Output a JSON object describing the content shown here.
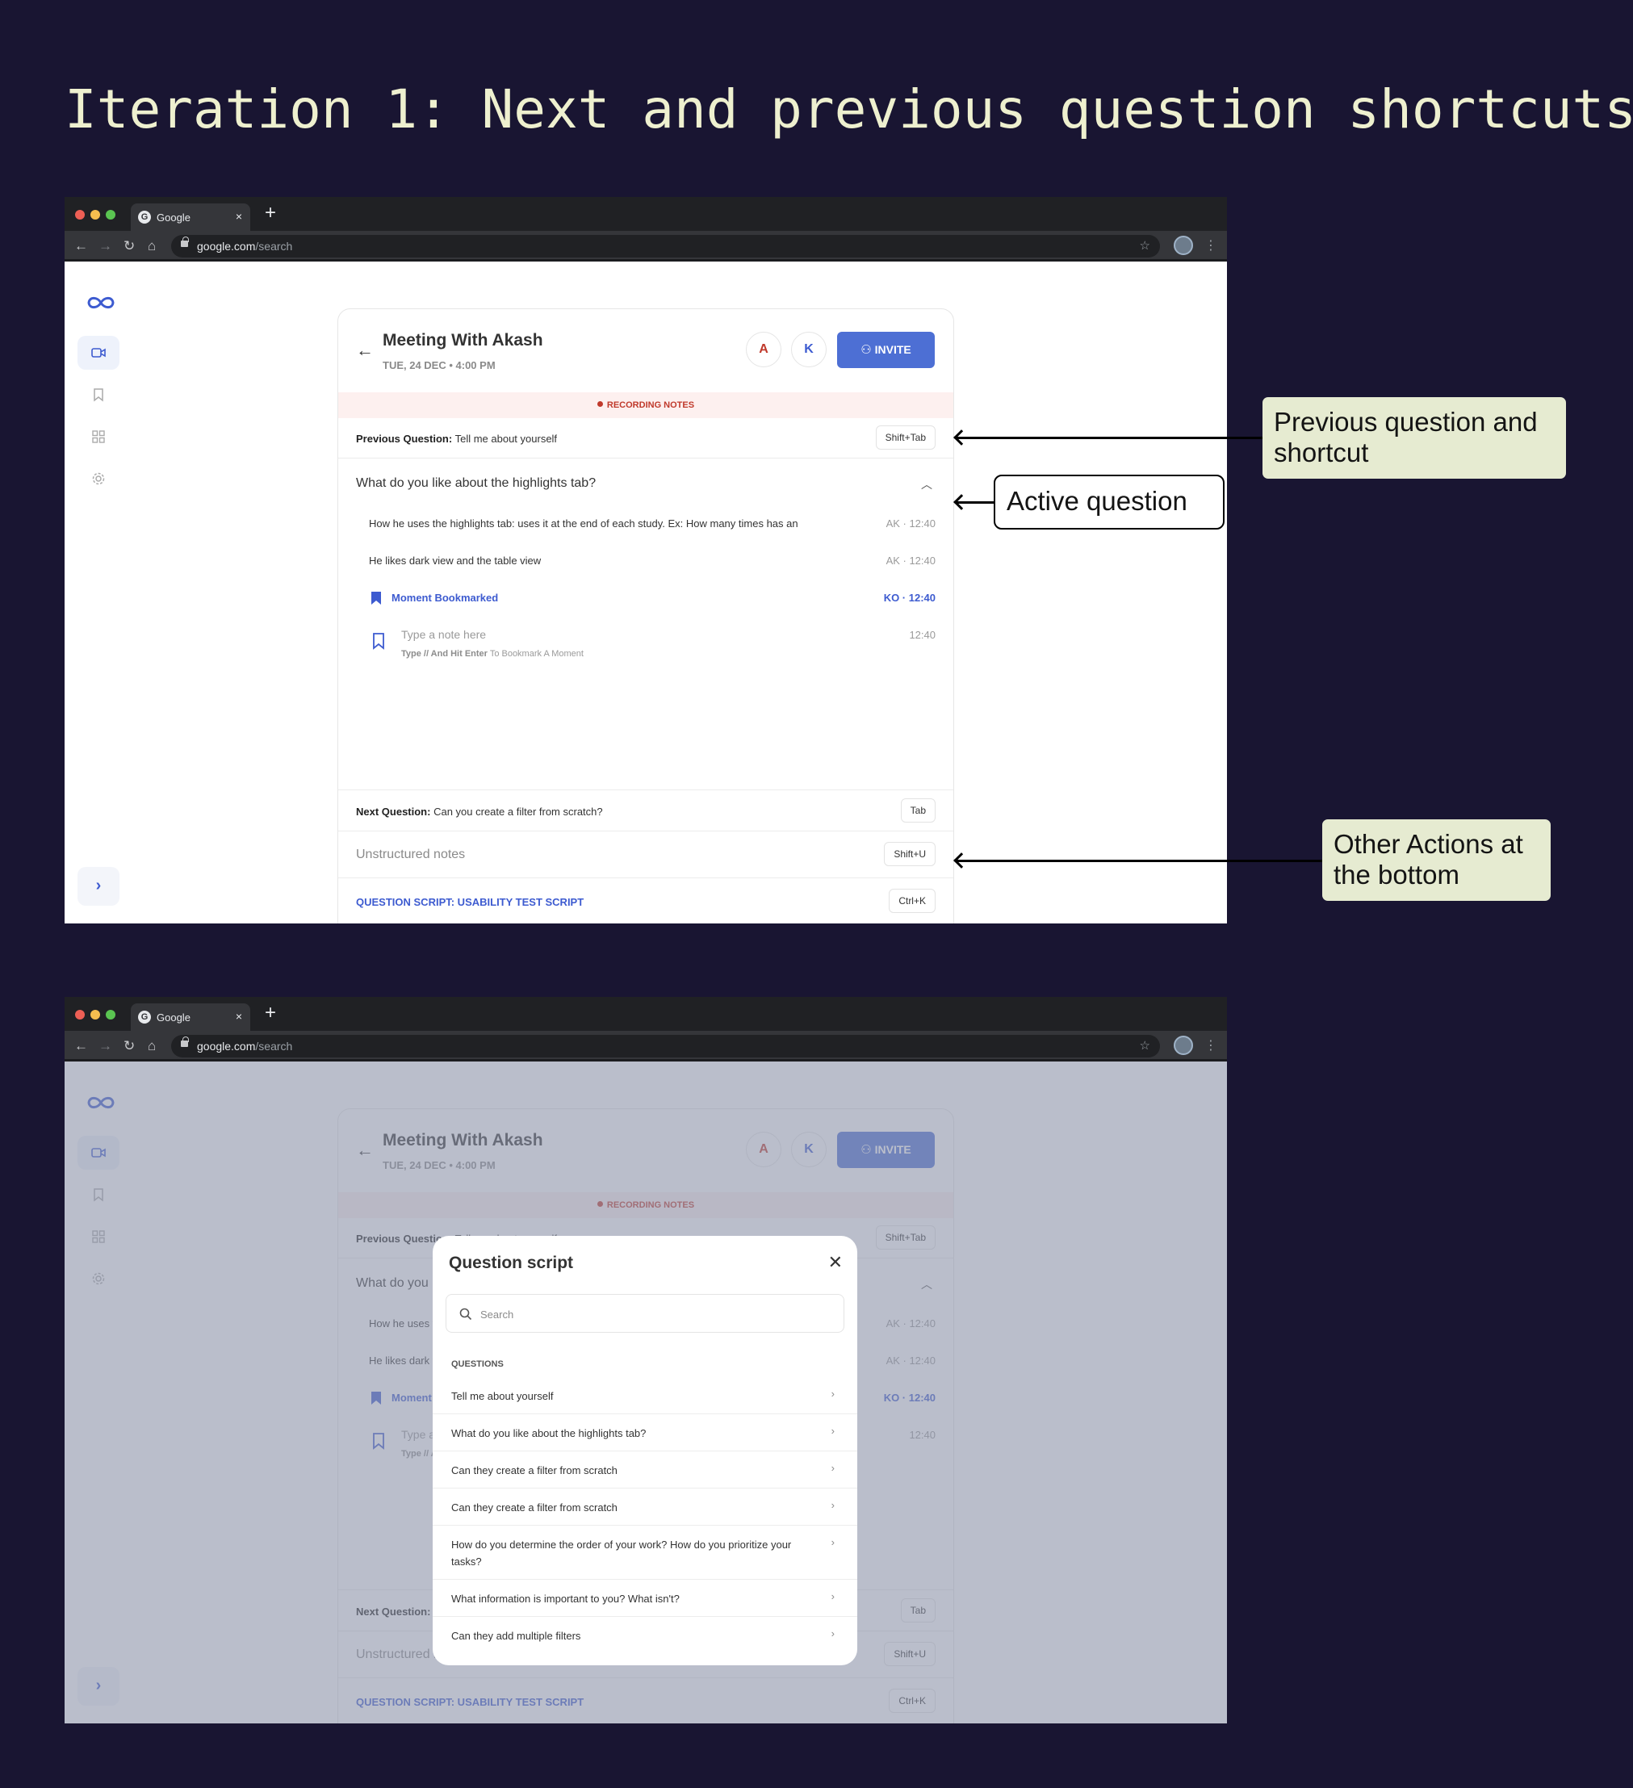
{
  "heading": "Iteration 1: Next and previous question shortcuts",
  "browser": {
    "tab_label": "Google",
    "tab_close": "×",
    "new_tab": "+",
    "url_domain": "google.com",
    "url_path": "/search",
    "back": "←",
    "forward": "→",
    "reload": "↻",
    "home": "⌂",
    "star": "☆",
    "menu": "⋮"
  },
  "meeting": {
    "title": "Meeting With Akash",
    "date": "TUE, 24 DEC • 4:00 PM",
    "participants": [
      "A",
      "K"
    ],
    "invite_label": "INVITE",
    "recording_label": "RECORDING NOTES",
    "previous_label": "Previous Question:",
    "previous_text": "Tell me about yourself",
    "previous_shortcut": "Shift+Tab",
    "active_question": "What do you like about the highlights tab?",
    "notes": [
      {
        "text": "How he uses the highlights tab: uses it at the end of each study. Ex: How many times has an",
        "stamp": "AK · 12:40"
      },
      {
        "text": "He likes dark view and the table view",
        "stamp": "AK · 12:40"
      }
    ],
    "bookmark_text": "Moment Bookmarked",
    "bookmark_stamp": "KO · 12:40",
    "type_placeholder": "Type a note here",
    "type_stamp": "12:40",
    "hint_bold": "Type // And Hit Enter",
    "hint_rest": "To Bookmark A Moment",
    "next_label": "Next Question:",
    "next_text": "Can you create a filter from scratch?",
    "next_shortcut": "Tab",
    "unstructured_label": "Unstructured notes",
    "unstructured_shortcut": "Shift+U",
    "script_label": "QUESTION SCRIPT: USABILITY TEST SCRIPT",
    "script_shortcut": "Ctrl+K"
  },
  "annotations": {
    "previous": "Previous question and shortcut",
    "active": "Active question",
    "other": "Other Actions at the bottom"
  },
  "modal": {
    "title": "Question script",
    "search_placeholder": "Search",
    "section": "QUESTIONS",
    "questions": [
      "Tell me about yourself",
      "What do you like about the highlights tab?",
      "Can they create a filter from scratch",
      "Can they create a filter from scratch",
      "How do you determine the order of your work? How do you prioritize your tasks?",
      "What information is important to you? What isn't?",
      "Can they add multiple filters"
    ]
  },
  "colors": {
    "background": "#191532",
    "heading": "#eef0cf",
    "accent": "#4d6fd4",
    "recording": "#c0392b",
    "callout": "#e6ebd1"
  }
}
